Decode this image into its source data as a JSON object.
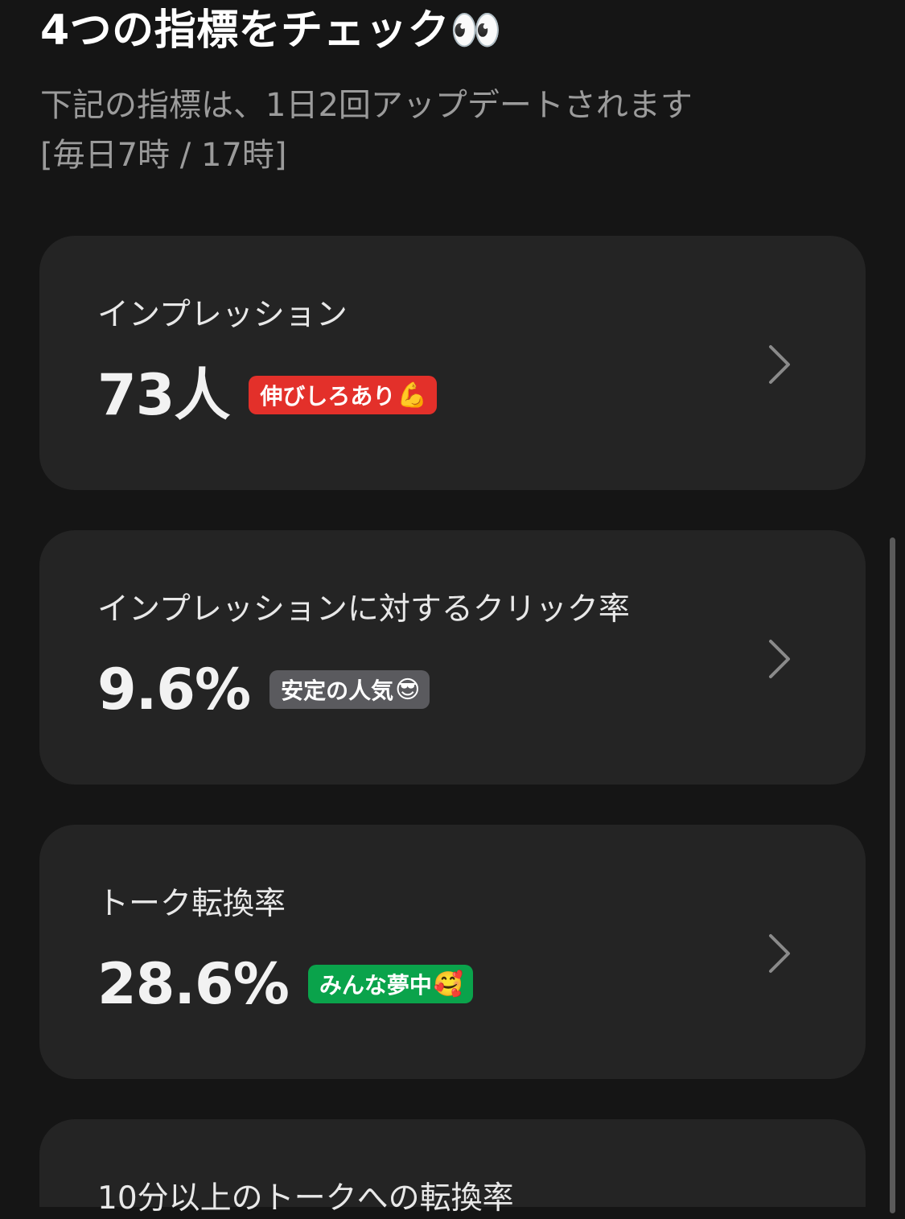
{
  "header": {
    "title": "4つの指標をチェック👀",
    "subtitle_line1": "下記の指標は、1日2回アップデートされます",
    "subtitle_line2": "[毎日7時 / 17時]"
  },
  "colors": {
    "badge_red": "#e3302a",
    "badge_gray": "#5a5a5e",
    "badge_green": "#0aa34b"
  },
  "metrics": [
    {
      "label": "インプレッション",
      "value": "73人",
      "badge_text": "伸びしろあり",
      "badge_emoji": "💪",
      "badge_color": "#e3302a"
    },
    {
      "label": "インプレッションに対するクリック率",
      "value": "9.6%",
      "badge_text": "安定の人気",
      "badge_emoji": "😎",
      "badge_color": "#5a5a5e"
    },
    {
      "label": "トーク転換率",
      "value": "28.6%",
      "badge_text": "みんな夢中",
      "badge_emoji": "🥰",
      "badge_color": "#0aa34b"
    },
    {
      "label": "10分以上のトークへの転換率"
    }
  ],
  "icons": {
    "chevron": "chevron-right-icon"
  }
}
